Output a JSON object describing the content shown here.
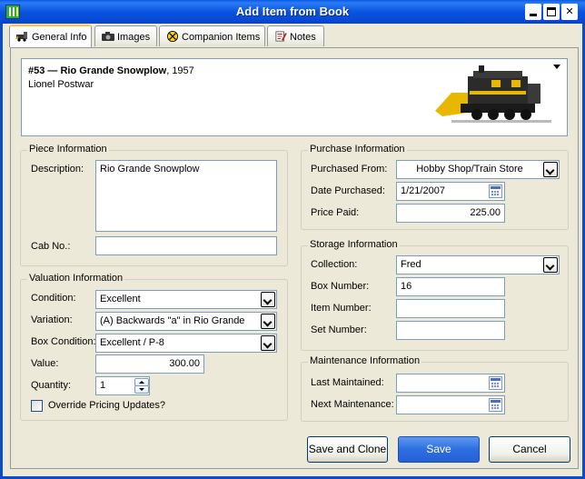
{
  "window": {
    "title": "Add Item from Book"
  },
  "tabs": [
    {
      "label": "General Info",
      "icon": "train-icon"
    },
    {
      "label": "Images",
      "icon": "camera-icon"
    },
    {
      "label": "Companion Items",
      "icon": "crossing-sign-icon"
    },
    {
      "label": "Notes",
      "icon": "notes-icon"
    }
  ],
  "header": {
    "item_number": "#53 — Rio Grande Snowplow",
    "year": ", 1957",
    "subtitle": "Lionel Postwar",
    "image": "locomotive-photo"
  },
  "piece": {
    "legend": "Piece Information",
    "description_label": "Description:",
    "description_value": "Rio Grande Snowplow",
    "cab_label": "Cab No.:",
    "cab_value": ""
  },
  "valuation": {
    "legend": "Valuation Information",
    "condition_label": "Condition:",
    "condition_value": "Excellent",
    "variation_label": "Variation:",
    "variation_value": "(A) Backwards \"a\" in Rio Grande",
    "box_condition_label": "Box Condition:",
    "box_condition_value": "Excellent / P-8",
    "value_label": "Value:",
    "value_value": "300.00",
    "quantity_label": "Quantity:",
    "quantity_value": "1",
    "override_label": "Override Pricing Updates?"
  },
  "purchase": {
    "legend": "Purchase Information",
    "from_label": "Purchased From:",
    "from_value": "Hobby Shop/Train Store",
    "date_label": "Date Purchased:",
    "date_value": "1/21/2007",
    "price_label": "Price Paid:",
    "price_value": "225.00"
  },
  "storage": {
    "legend": "Storage Information",
    "collection_label": "Collection:",
    "collection_value": "Fred",
    "box_label": "Box Number:",
    "box_value": "16",
    "item_label": "Item Number:",
    "item_value": "",
    "set_label": "Set Number:",
    "set_value": ""
  },
  "maintenance": {
    "legend": "Maintenance Information",
    "last_label": "Last Maintained:",
    "last_value": "",
    "next_label": "Next Maintenance:",
    "next_value": ""
  },
  "buttons": {
    "save_clone": "Save and Clone",
    "save": "Save",
    "cancel": "Cancel"
  },
  "colors": {
    "titlebar": "#0a54e0",
    "accent": "#ffc83c",
    "primary_button": "#2d6ee0"
  }
}
